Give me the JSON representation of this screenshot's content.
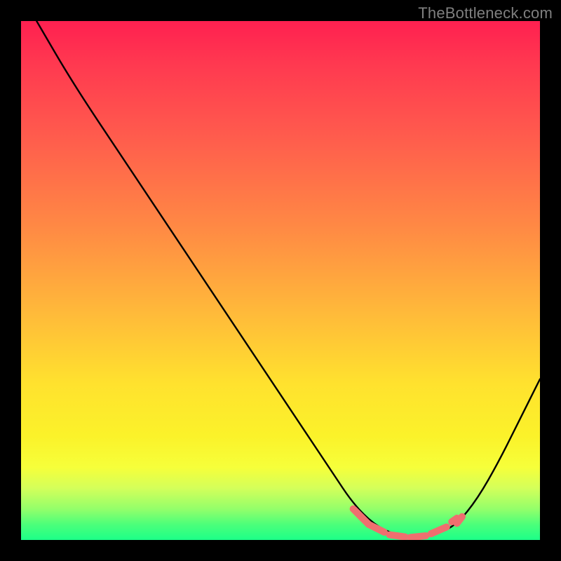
{
  "watermark": "TheBottleneck.com",
  "chart_data": {
    "type": "line",
    "title": "",
    "xlabel": "",
    "ylabel": "",
    "xlim": [
      0,
      100
    ],
    "ylim": [
      0,
      100
    ],
    "gradient_stops": [
      {
        "pct": 0,
        "color": "#ff2050"
      },
      {
        "pct": 8,
        "color": "#ff3850"
      },
      {
        "pct": 22,
        "color": "#ff5b4d"
      },
      {
        "pct": 40,
        "color": "#ff8a44"
      },
      {
        "pct": 56,
        "color": "#ffb93a"
      },
      {
        "pct": 70,
        "color": "#ffe22e"
      },
      {
        "pct": 80,
        "color": "#fbf22a"
      },
      {
        "pct": 86,
        "color": "#f6ff3a"
      },
      {
        "pct": 90,
        "color": "#d4ff5a"
      },
      {
        "pct": 94,
        "color": "#94ff6a"
      },
      {
        "pct": 97,
        "color": "#4cff7a"
      },
      {
        "pct": 100,
        "color": "#1cff88"
      }
    ],
    "series": [
      {
        "name": "bottleneck-curve",
        "color": "#000000",
        "points": [
          {
            "x": 3,
            "y": 100
          },
          {
            "x": 10,
            "y": 88
          },
          {
            "x": 20,
            "y": 73
          },
          {
            "x": 30,
            "y": 58
          },
          {
            "x": 40,
            "y": 43
          },
          {
            "x": 50,
            "y": 28
          },
          {
            "x": 60,
            "y": 13
          },
          {
            "x": 64,
            "y": 7
          },
          {
            "x": 68,
            "y": 3
          },
          {
            "x": 72,
            "y": 1
          },
          {
            "x": 76,
            "y": 0.5
          },
          {
            "x": 80,
            "y": 1
          },
          {
            "x": 84,
            "y": 3
          },
          {
            "x": 88,
            "y": 8
          },
          {
            "x": 92,
            "y": 15
          },
          {
            "x": 96,
            "y": 23
          },
          {
            "x": 100,
            "y": 31
          }
        ]
      }
    ],
    "highlight": {
      "color": "#ef6f6f",
      "segments": [
        {
          "x1": 64,
          "y1": 6,
          "x2": 67,
          "y2": 3
        },
        {
          "x1": 67,
          "y1": 3,
          "x2": 70,
          "y2": 1.5
        },
        {
          "x1": 71,
          "y1": 1,
          "x2": 74,
          "y2": 0.6
        },
        {
          "x1": 75,
          "y1": 0.5,
          "x2": 78,
          "y2": 0.8
        },
        {
          "x1": 79,
          "y1": 1.2,
          "x2": 82,
          "y2": 2.5
        },
        {
          "x1": 83,
          "y1": 3.5,
          "x2": 84,
          "y2": 4.2
        },
        {
          "x1": 84,
          "y1": 3.2,
          "x2": 85,
          "y2": 4.5
        }
      ]
    }
  }
}
